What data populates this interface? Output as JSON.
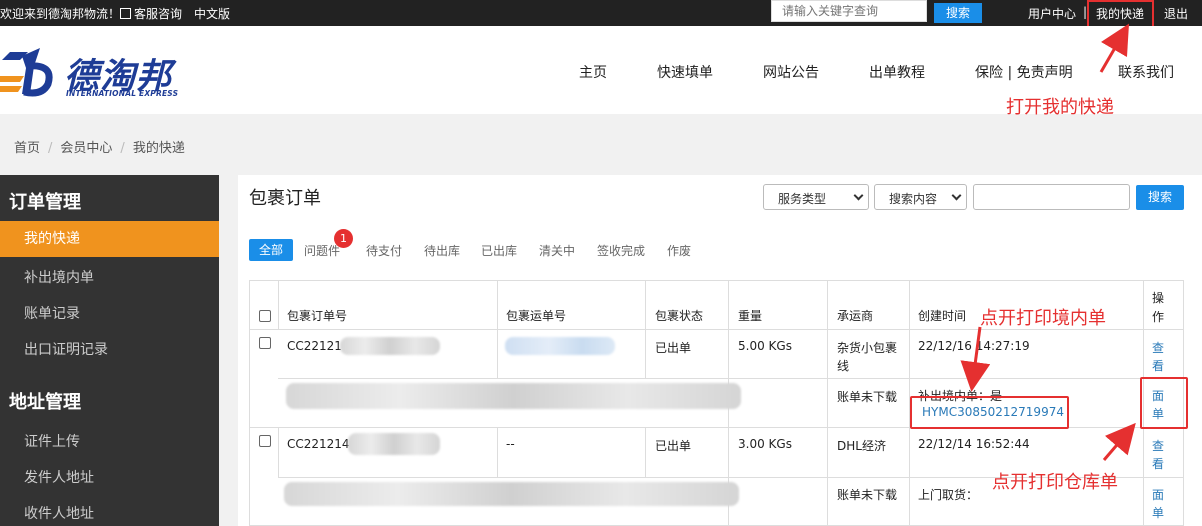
{
  "topbar": {
    "welcome": "欢迎来到德淘邦物流！",
    "service_label": "客服咨询",
    "language": "中文版",
    "search_placeholder": "请输入关键字查询",
    "search_button": "搜索",
    "user_center": "用户中心",
    "separator": "|",
    "my_express": "我的快递",
    "logout": "退出"
  },
  "logo": {
    "cn": "德淘邦",
    "en": "INTERNATIONAL EXPRESS"
  },
  "nav": [
    "主页",
    "快速填单",
    "网站公告",
    "出单教程",
    "保险 | 免责声明",
    "联系我们"
  ],
  "annotations": {
    "open_my_express": "打开我的快递",
    "print_domestic": "点开打印境内单",
    "print_warehouse": "点开打印仓库单"
  },
  "breadcrumb": [
    "首页",
    "会员中心",
    "我的快递"
  ],
  "sidebar": {
    "order_group": "订单管理",
    "order_items": [
      "我的快递",
      "补出境内单",
      "账单记录",
      "出口证明记录"
    ],
    "address_group": "地址管理",
    "address_items": [
      "证件上传",
      "发件人地址",
      "收件人地址"
    ]
  },
  "main": {
    "title": "包裹订单",
    "service_type": "服务类型",
    "search_content": "搜索内容",
    "search_button": "搜索",
    "tabs": [
      "全部",
      "问题件",
      "待支付",
      "待出库",
      "已出库",
      "清关中",
      "签收完成",
      "作废"
    ],
    "problem_badge": "1"
  },
  "table": {
    "headers": [
      "包裹订单号",
      "包裹运单号",
      "包裹状态",
      "重量",
      "承运商",
      "创建时间",
      "操作"
    ],
    "rows": [
      {
        "order_no": "CC22121",
        "waybill": "",
        "status": "已出单",
        "weight": "5.00 KGs",
        "carrier": "杂货小包裹线",
        "created": "22/12/16 14:27:19",
        "view": "查看",
        "bill_status": "账单未下载",
        "supplement": "补出境内单：是",
        "tracking": "HYMC30850212719974",
        "sheet": "面单"
      },
      {
        "order_no": "CC221214",
        "waybill": "--",
        "status": "已出单",
        "weight": "3.00 KGs",
        "carrier": "DHL经济",
        "created": "22/12/14 16:52:44",
        "view": "查看",
        "bill_status": "账单未下载",
        "supplement": "上门取货：",
        "sheet": "面单"
      }
    ]
  },
  "colors": {
    "accent_blue": "#1a8ee8",
    "sidebar_bg": "#333333",
    "active_orange": "#f0931e",
    "annotation_red": "#e53030",
    "brand_navy": "#1e3c96"
  }
}
